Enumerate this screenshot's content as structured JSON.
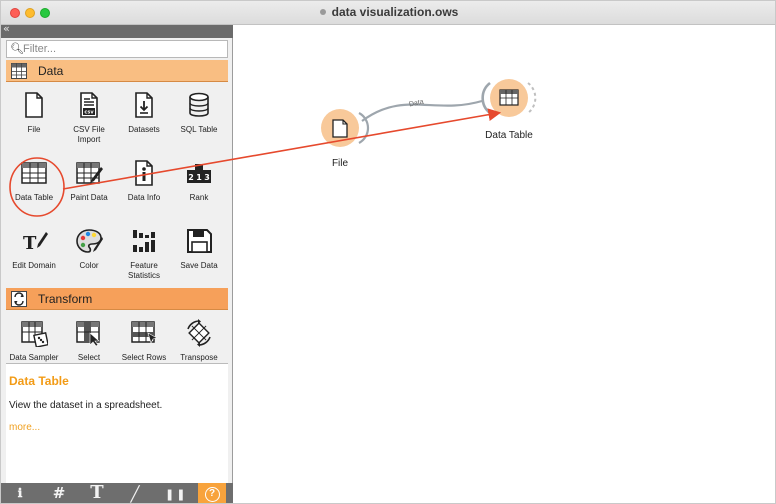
{
  "window": {
    "title": "data visualization.ows"
  },
  "toolbox": {
    "collapse_glyph": "«",
    "filter_placeholder": "Filter...",
    "categories": [
      {
        "name": "Data",
        "color": "#f9be82",
        "widgets": [
          {
            "label": "File",
            "icon": "file-icon"
          },
          {
            "label": "CSV File Import",
            "icon": "csv-file-icon"
          },
          {
            "label": "Datasets",
            "icon": "datasets-icon"
          },
          {
            "label": "SQL Table",
            "icon": "database-icon"
          },
          {
            "label": "Data Table",
            "icon": "table-icon",
            "highlighted": true
          },
          {
            "label": "Paint Data",
            "icon": "paint-data-icon"
          },
          {
            "label": "Data Info",
            "icon": "info-icon"
          },
          {
            "label": "Rank",
            "icon": "rank-icon"
          },
          {
            "label": "Edit Domain",
            "icon": "edit-domain-icon"
          },
          {
            "label": "Color",
            "icon": "palette-icon"
          },
          {
            "label": "Feature Statistics",
            "icon": "bar-stats-icon"
          },
          {
            "label": "Save Data",
            "icon": "save-icon"
          }
        ]
      },
      {
        "name": "Transform",
        "color": "#f6a05a",
        "widgets": [
          {
            "label": "Data Sampler",
            "icon": "data-sampler-icon"
          },
          {
            "label": "Select Columns",
            "icon": "select-columns-icon"
          },
          {
            "label": "Select Rows",
            "icon": "select-rows-icon"
          },
          {
            "label": "Transpose",
            "icon": "transpose-icon"
          }
        ]
      }
    ]
  },
  "description": {
    "title": "Data Table",
    "text": "View the dataset in a spreadsheet.",
    "more_link": "more..."
  },
  "bottom_toolbar": {
    "buttons": [
      {
        "glyph": "ℹ",
        "icon": "info-icon"
      },
      {
        "glyph": "#",
        "icon": "hash-icon"
      },
      {
        "glyph": "T",
        "icon": "text-annotation-icon"
      },
      {
        "glyph": "╱",
        "icon": "arrow-annotation-icon"
      },
      {
        "glyph": "❚❚",
        "icon": "pause-icon"
      },
      {
        "glyph": "?",
        "icon": "help-icon"
      }
    ]
  },
  "workflow": {
    "nodes": [
      {
        "label": "File",
        "icon": "file-icon"
      },
      {
        "label": "Data Table",
        "icon": "table-icon"
      }
    ],
    "link_label": "Data",
    "accent_color": "#f8c99a",
    "annotation_color": "#e6492d"
  }
}
